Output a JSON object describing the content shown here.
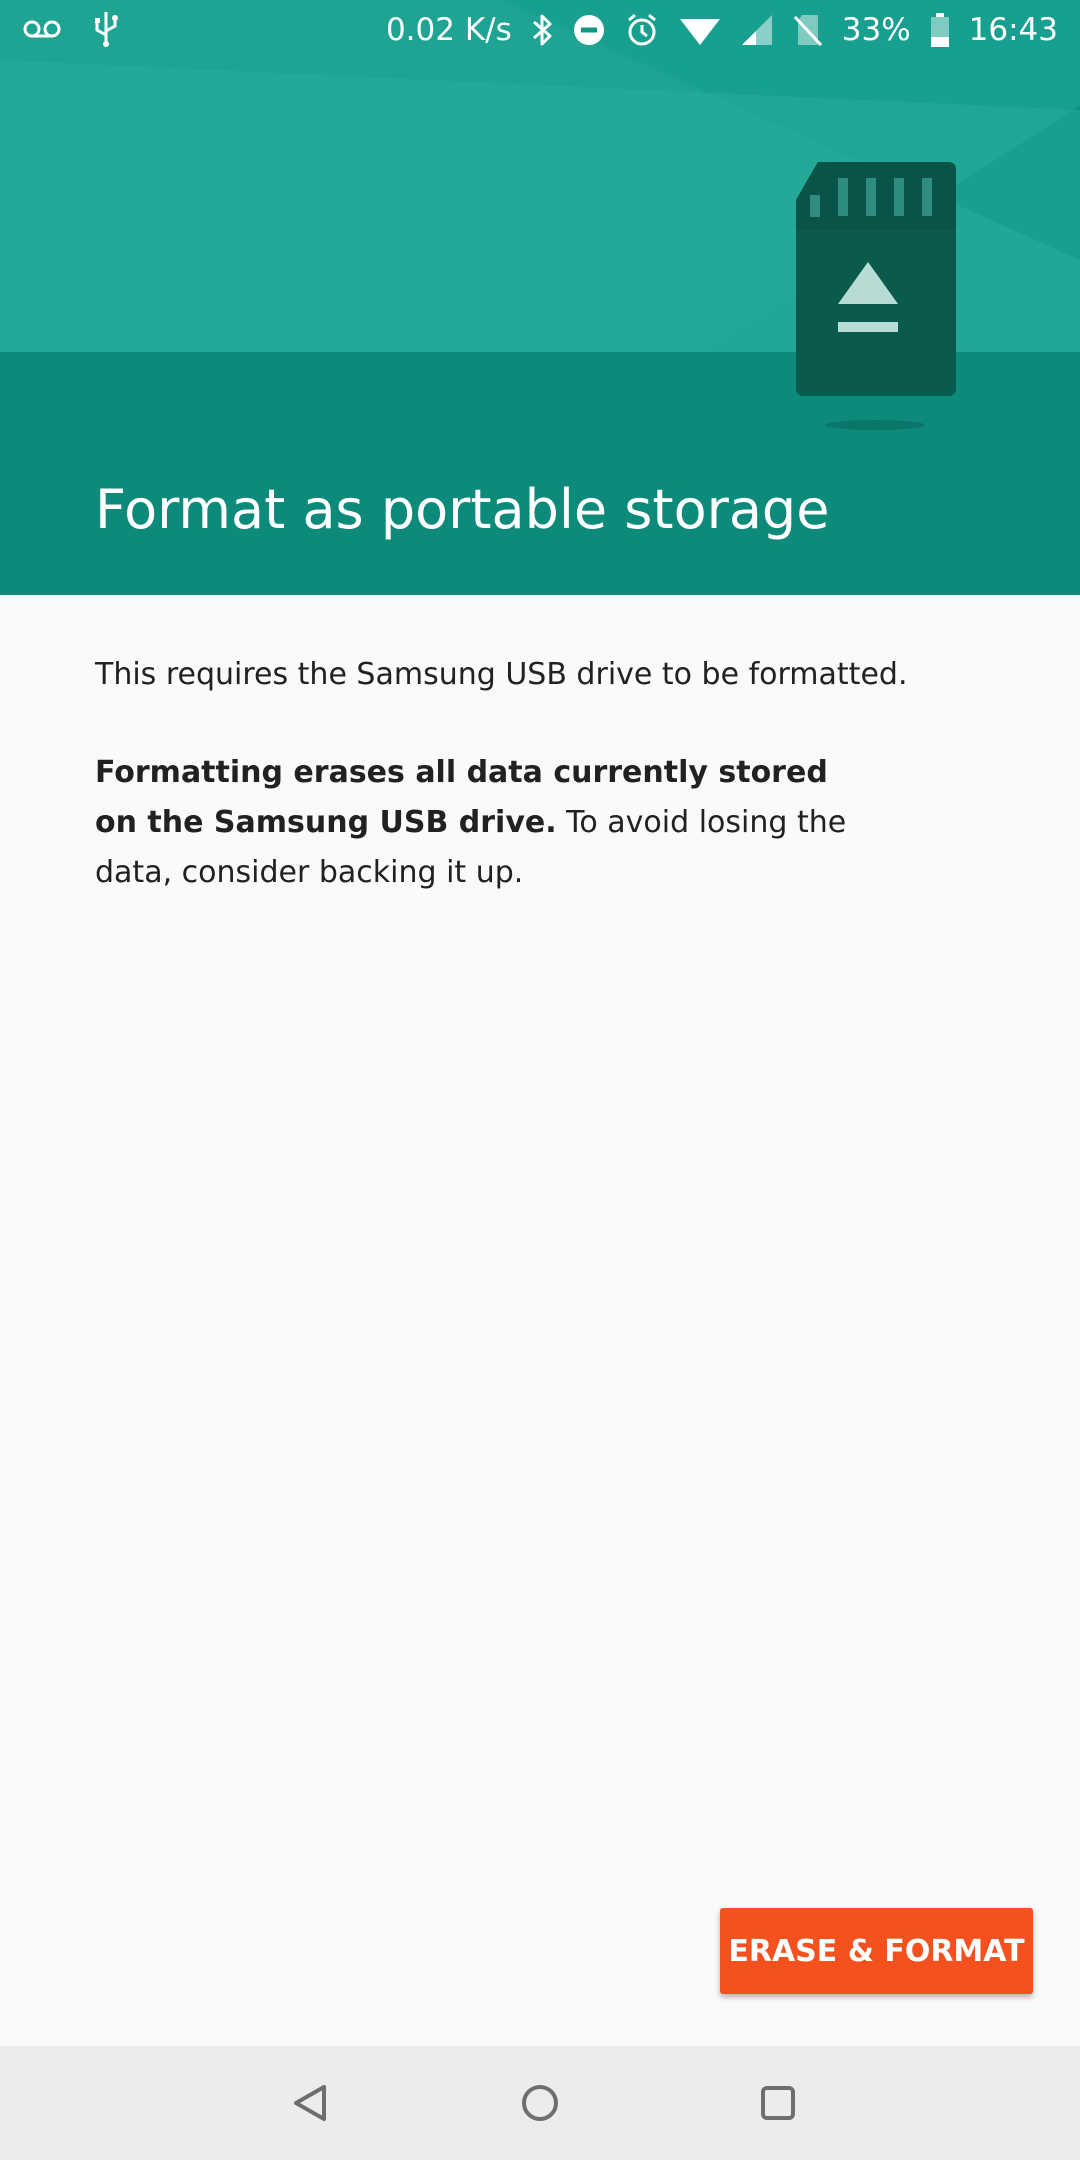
{
  "status_bar": {
    "net_speed": "0.02 K/s",
    "battery": "33%",
    "time": "16:43",
    "icons": [
      "voicemail-icon",
      "usb-icon",
      "bluetooth-icon",
      "do-not-disturb-icon",
      "alarm-icon",
      "wifi-icon",
      "cell-signal-icon",
      "no-sim-icon",
      "battery-icon"
    ]
  },
  "header": {
    "title": "Format as portable storage",
    "illustration": "sd-card-eject-icon",
    "colors": {
      "primary": "#0e9483",
      "dark": "#00695c",
      "light": "#2fae9c"
    }
  },
  "body": {
    "intro": "This requires the Samsung USB drive to be formatted.",
    "warning_bold": "Formatting erases all data currently stored on the Samsung USB drive.",
    "warning_rest": " To avoid losing the data, consider backing it up."
  },
  "actions": {
    "erase_label": "ERASE & FORMAT",
    "accent": "#f4511e"
  },
  "nav_bar": {
    "buttons": [
      "back-icon",
      "home-icon",
      "recents-icon"
    ]
  }
}
